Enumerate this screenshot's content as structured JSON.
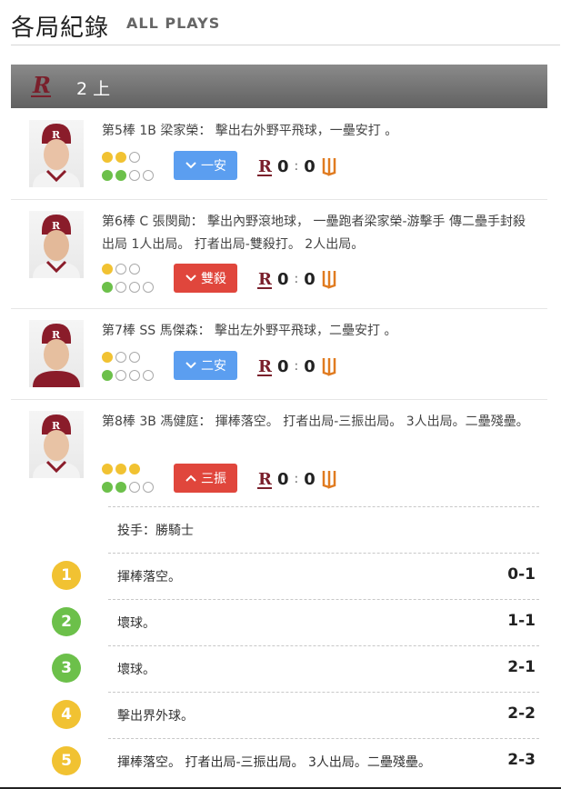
{
  "header": {
    "title": "各局紀錄",
    "subtitle": "ALL PLAYS"
  },
  "inning": {
    "label": "2 上",
    "team_logo_icon": "rakuten-monkeys-logo"
  },
  "plays": [
    {
      "text": "第5棒 1B 梁家榮： 擊出右外野平飛球，一壘安打 。",
      "balls": [
        "y",
        "y",
        "e"
      ],
      "outs": [
        "g",
        "g",
        "e",
        "e"
      ],
      "result": "一安",
      "result_icon": "chevron-down-icon",
      "result_color": "#5b9ef0",
      "away_score": "0",
      "home_score": "0"
    },
    {
      "text": "第6棒 C 張閔勛： 擊出內野滾地球， 一壘跑者梁家榮-游擊手 傳二壘手封殺出局 1人出局。 打者出局-雙殺打。 2人出局。",
      "balls": [
        "y",
        "e",
        "e"
      ],
      "outs": [
        "g",
        "e",
        "e",
        "e"
      ],
      "result": "雙殺",
      "result_icon": "chevron-down-icon",
      "result_color": "#e0463c",
      "away_score": "0",
      "home_score": "0"
    },
    {
      "text": "第7棒 SS 馬傑森： 擊出左外野平飛球，二壘安打 。",
      "balls": [
        "y",
        "e",
        "e"
      ],
      "outs": [
        "g",
        "e",
        "e",
        "e"
      ],
      "result": "二安",
      "result_icon": "chevron-down-icon",
      "result_color": "#5b9ef0",
      "away_score": "0",
      "home_score": "0"
    },
    {
      "text": "第8棒 3B 馮健庭： 揮棒落空。 打者出局-三振出局。 3人出局。二壘殘壘。",
      "balls": [
        "y",
        "y",
        "y"
      ],
      "outs": [
        "g",
        "g",
        "e",
        "e"
      ],
      "result": "三振",
      "result_icon": "chevron-up-icon",
      "result_color": "#e0463c",
      "away_score": "0",
      "home_score": "0"
    }
  ],
  "pitcher": {
    "label": "投手：勝騎士"
  },
  "pitches": [
    {
      "num": "1",
      "color": "y",
      "text": "揮棒落空。",
      "count": "0-1"
    },
    {
      "num": "2",
      "color": "g",
      "text": "壞球。",
      "count": "1-1"
    },
    {
      "num": "3",
      "color": "g",
      "text": "壞球。",
      "count": "2-1"
    },
    {
      "num": "4",
      "color": "y",
      "text": "擊出界外球。",
      "count": "2-2"
    },
    {
      "num": "5",
      "color": "y",
      "text": "揮棒落空。 打者出局-三振出局。 3人出局。二壘殘壘。",
      "count": "2-3"
    }
  ],
  "colors": {
    "rakuten": "#7a1f2b",
    "wei_chuan": "#e07b20",
    "ball_yellow": "#f1c232",
    "out_green": "#6cc04a"
  }
}
